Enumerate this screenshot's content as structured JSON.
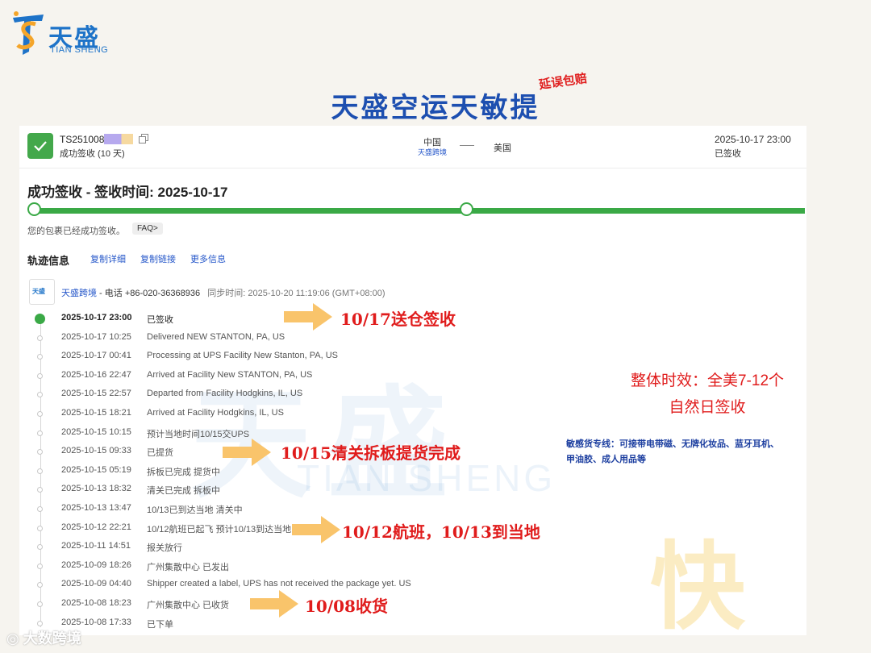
{
  "brand": {
    "name_cn": "天盛",
    "name_en": "TIAN SHENG",
    "primary_color": "#1e73c8"
  },
  "banner": {
    "title": "天盛空运天敏提",
    "tag": "延误包赔"
  },
  "shipment": {
    "tracking_prefix": "TS251008",
    "status_short": "成功签收 (10 天)",
    "origin": "中国",
    "origin_carrier": "天盛跨境",
    "destination": "美国",
    "last_update_time": "2025-10-17 23:00",
    "last_update_status": "已签收",
    "headline": "成功签收 - 签收时间: 2025-10-17",
    "progress_fraction": 1.0,
    "progress_note": "您的包裹已经成功签收。",
    "faq_label": "FAQ>"
  },
  "tracking": {
    "title": "轨迹信息",
    "links": [
      "复制详细",
      "复制链接",
      "更多信息"
    ],
    "carrier_logo_text": "天盛",
    "carrier_name": "天盛跨境",
    "carrier_phone": " - 电话 +86-020-36368936",
    "sync_time": "同步时间: 2025-10-20 11:19:06 (GMT+08:00)",
    "events": [
      {
        "time": "2025-10-17 23:00",
        "desc": "已签收"
      },
      {
        "time": "2025-10-17 10:25",
        "desc": "Delivered NEW STANTON, PA, US"
      },
      {
        "time": "2025-10-17 00:41",
        "desc": "Processing at UPS Facility New Stanton, PA, US"
      },
      {
        "time": "2025-10-16 22:47",
        "desc": "Arrived at Facility New STANTON, PA, US"
      },
      {
        "time": "2025-10-15 22:57",
        "desc": "Departed from Facility Hodgkins, IL, US"
      },
      {
        "time": "2025-10-15 18:21",
        "desc": "Arrived at Facility Hodgkins, IL, US"
      },
      {
        "time": "2025-10-15 10:15",
        "desc": "预计当地时间10/15交UPS"
      },
      {
        "time": "2025-10-15 09:33",
        "desc": "已提货"
      },
      {
        "time": "2025-10-15 05:19",
        "desc": "拆板已完成 提货中"
      },
      {
        "time": "2025-10-13 18:32",
        "desc": "清关已完成 拆板中"
      },
      {
        "time": "2025-10-13 13:47",
        "desc": "10/13已到达当地 清关中"
      },
      {
        "time": "2025-10-12 22:21",
        "desc": "10/12航班已起飞 预计10/13到达当地"
      },
      {
        "time": "2025-10-11 14:51",
        "desc": "报关放行"
      },
      {
        "time": "2025-10-09 18:26",
        "desc": "广州集散中心 已发出"
      },
      {
        "time": "2025-10-09 04:40",
        "desc": "Shipper created a label, UPS has not received the package yet. US"
      },
      {
        "time": "2025-10-08 18:23",
        "desc": "广州集散中心 已收货"
      },
      {
        "time": "2025-10-08 17:33",
        "desc": "已下单"
      }
    ]
  },
  "annotations": {
    "a1": "10/17送仓签收",
    "a2": "10/15清关拆板提货完成",
    "a3": "10/12航班，10/13到当地",
    "a4": "10/08收货",
    "summary_line1": "整体时效：全美7-12个",
    "summary_line2": "自然日签收",
    "sensitive_line1": "敏感货专线：可接带电带磁、无牌化妆品、蓝牙耳机、",
    "sensitive_line2": "甲油胶、成人用品等"
  },
  "watermark": {
    "cn": "天盛",
    "en": "TIAN SHENG",
    "kuai": "快",
    "footer": "大数跨境"
  },
  "colors": {
    "success": "#3aa946",
    "link": "#2456c9",
    "annotation_red": "#e01c1c",
    "arrow": "#f9c46b"
  }
}
